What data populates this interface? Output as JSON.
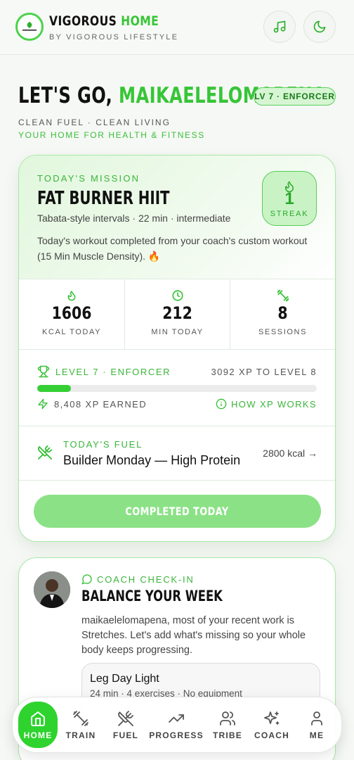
{
  "header": {
    "brand_main": "VIGOROUS",
    "brand_accent": "HOME",
    "brand_sub": "BY VIGOROUS LIFESTYLE",
    "logo_text": "Vigorous Lifestyle"
  },
  "greeting": {
    "prefix": "LET'S GO,",
    "name": "MAIKAELELOMAPENA",
    "level_pill": "LV 7 · ENFORCER",
    "tagline": "CLEAN FUEL · CLEAN LIVING",
    "subtagline": "YOUR HOME FOR HEALTH & FITNESS"
  },
  "mission": {
    "label": "TODAY'S MISSION",
    "title": "FAT BURNER HIIT",
    "subtitle": "Tabata-style intervals · 22 min · intermediate",
    "description": "Today's workout completed from your coach's custom workout (15 Min Muscle Density). 🔥",
    "streak_value": "1",
    "streak_label": "STREAK"
  },
  "stats": [
    {
      "value": "1606",
      "label": "KCAL TODAY",
      "icon": "flame-icon"
    },
    {
      "value": "212",
      "label": "MIN TODAY",
      "icon": "clock-icon"
    },
    {
      "value": "8",
      "label": "SESSIONS",
      "icon": "dumbbell-icon"
    }
  ],
  "xp": {
    "level": "LEVEL 7 · ENFORCER",
    "to_next": "3092 XP TO LEVEL 8",
    "progress_fraction": 0.12,
    "earned": "8,408 XP EARNED",
    "how": "HOW XP WORKS"
  },
  "fuel": {
    "label": "TODAY'S FUEL",
    "name": "Builder Monday — High Protein",
    "kcal": "2800 kcal →"
  },
  "complete_button": "COMPLETED TODAY",
  "coach": {
    "label": "COACH CHECK-IN",
    "title": "BALANCE YOUR WEEK",
    "body": "maikaelelomapena, most of your recent work is Stretches. Let's add what's missing so your whole body keeps progressing.",
    "suggestion_title": "Leg Day Light",
    "suggestion_sub": "24 min · 4 exercises · No equipment"
  },
  "nav": [
    {
      "label": "HOME",
      "icon": "home-icon",
      "active": true
    },
    {
      "label": "TRAIN",
      "icon": "dumbbell-icon"
    },
    {
      "label": "FUEL",
      "icon": "utensils-icon"
    },
    {
      "label": "PROGRESS",
      "icon": "trending-up-icon"
    },
    {
      "label": "TRIBE",
      "icon": "users-icon"
    },
    {
      "label": "COACH",
      "icon": "sparkles-icon"
    },
    {
      "label": "ME",
      "icon": "user-icon"
    }
  ],
  "colors": {
    "accent": "#37c537",
    "accent_light": "#d6f6d3",
    "button_disabled": "#8be286",
    "nav_active": "#2ed32e"
  }
}
